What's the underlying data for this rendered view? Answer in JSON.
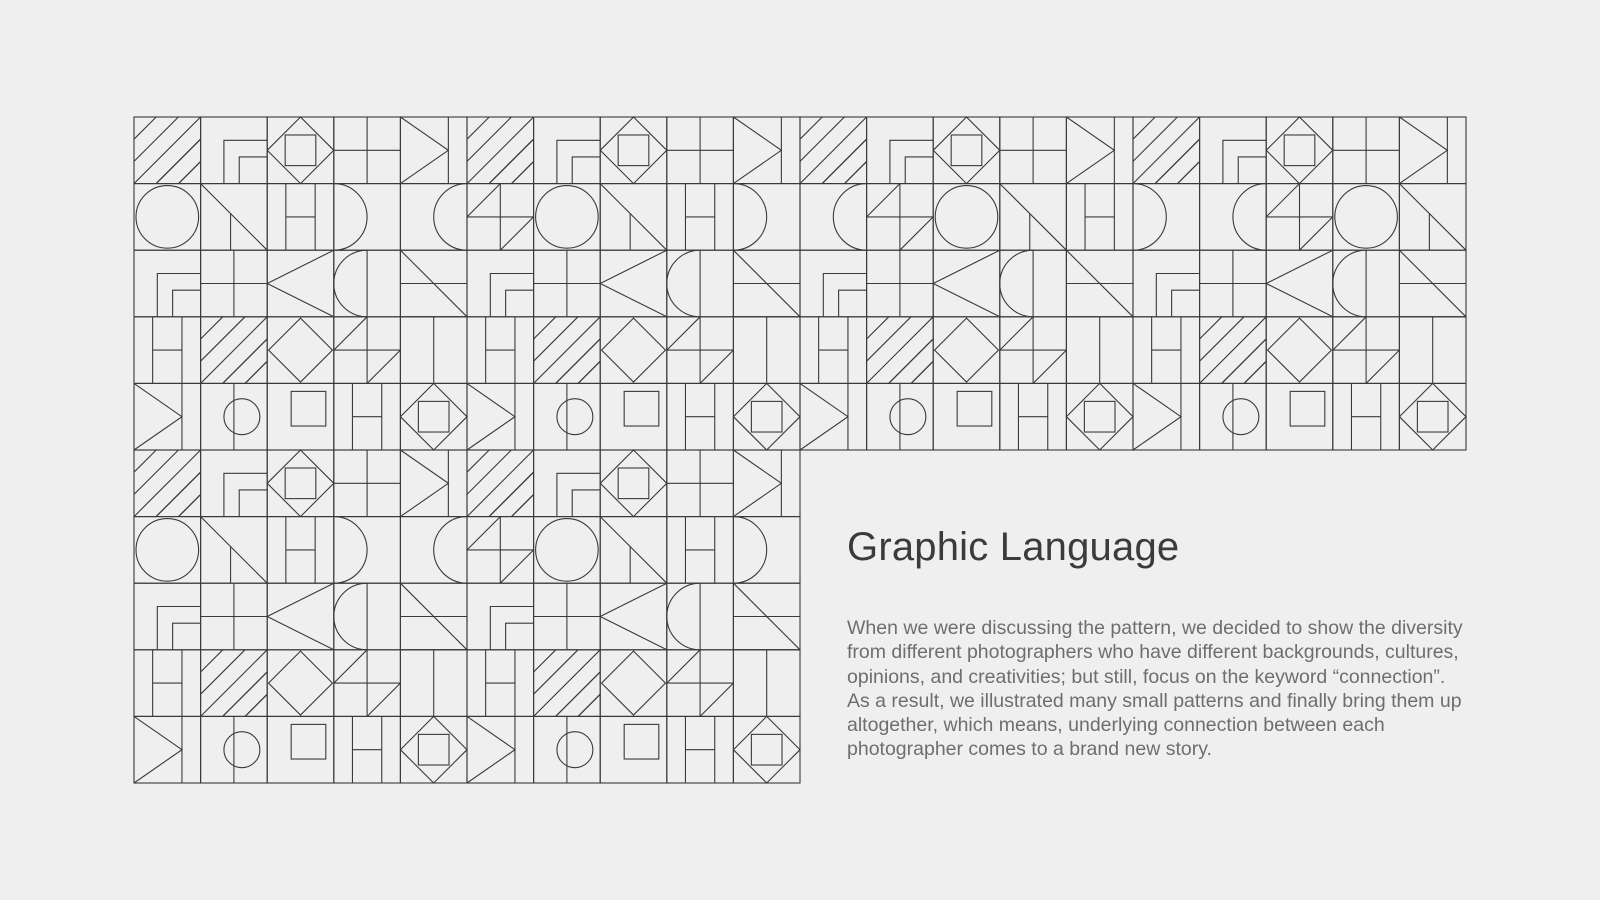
{
  "title": "Graphic Language",
  "body": "When we were discussing the pattern, we decided to show the diversity from different photographers who have different backgrounds, cultures, opinions, and creativities; but still, focus on the keyword “connection”. As a result, we illustrated many small patterns and finally bring them up altogether, which means, underlying connection between each photographer comes to a brand new story.",
  "colors": {
    "background": "#efefef",
    "line": "#3a3a3a",
    "title": "#3b3b3b",
    "body": "#6e6e6e"
  },
  "pattern": {
    "motifs": [
      [
        "stripes",
        "corner-steps",
        "diamond-square",
        "cross",
        "triangle-right"
      ],
      [
        "circle",
        "diagonal",
        "h-bars",
        "half-disk-right",
        "half-disk-left",
        "pinwheel"
      ],
      [
        "corner-steps",
        "cross",
        "triangle-left",
        "half-disk-left-small",
        "diagonal-bar"
      ],
      [
        "h-bars",
        "stripes",
        "diamond",
        "pinwheel",
        "t-bars"
      ],
      [
        "triangle-right",
        "circle-small",
        "square-small",
        "h-bars",
        "diamond-square"
      ]
    ]
  }
}
